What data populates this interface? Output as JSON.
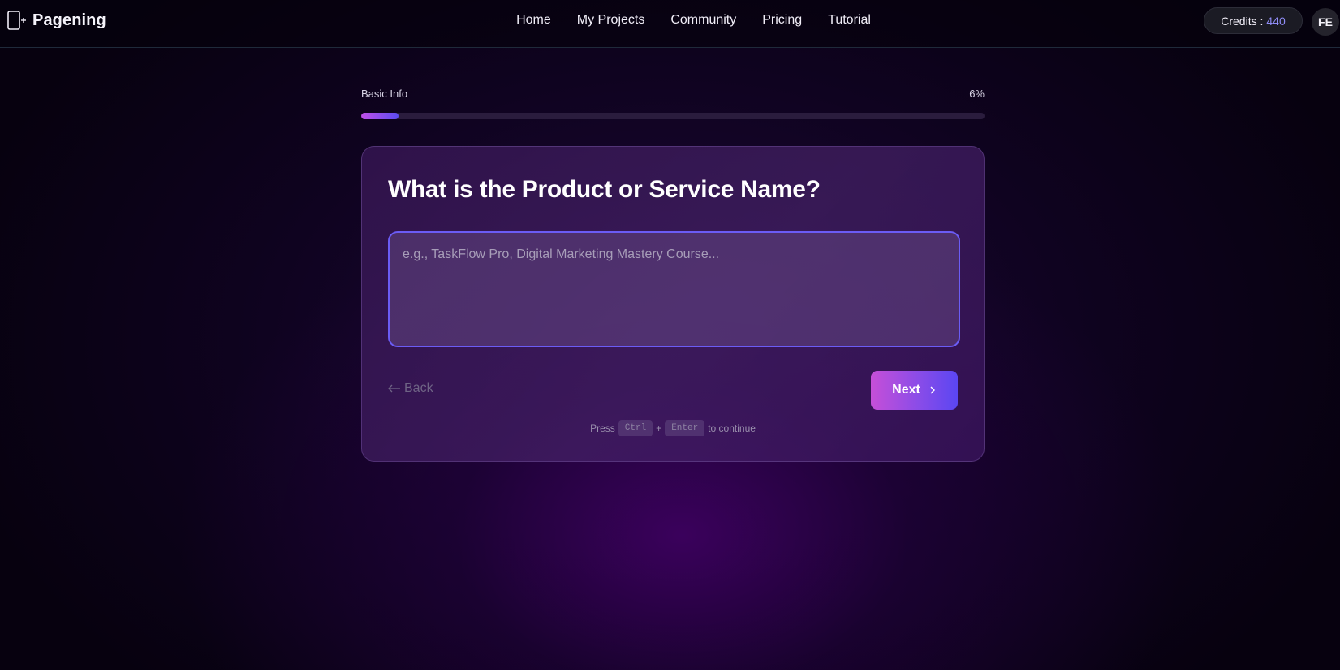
{
  "brand": {
    "name": "Pagening",
    "icon": "page-plus-icon"
  },
  "nav": {
    "items": [
      {
        "label": "Home"
      },
      {
        "label": "My Projects"
      },
      {
        "label": "Community"
      },
      {
        "label": "Pricing"
      },
      {
        "label": "Tutorial"
      }
    ]
  },
  "account": {
    "credits_label": "Credits :",
    "credits_value": "440",
    "avatar_initials": "FE"
  },
  "progress": {
    "step_label": "Basic Info",
    "percent_text": "6%",
    "percent": 6
  },
  "question": {
    "title": "What is the Product or Service Name?",
    "answer_value": "",
    "answer_placeholder": "e.g., TaskFlow Pro, Digital Marketing Mastery Course..."
  },
  "actions": {
    "back_label": "Back",
    "next_label": "Next"
  },
  "hint": {
    "prefix": "Press",
    "key1": "Ctrl",
    "plus": "+",
    "key2": "Enter",
    "suffix": "to continue"
  },
  "colors": {
    "accent": "#6b5cf5",
    "credits_value": "#8f8cf5",
    "gradient_start": "#c64fd8",
    "gradient_end": "#5b46f2"
  }
}
